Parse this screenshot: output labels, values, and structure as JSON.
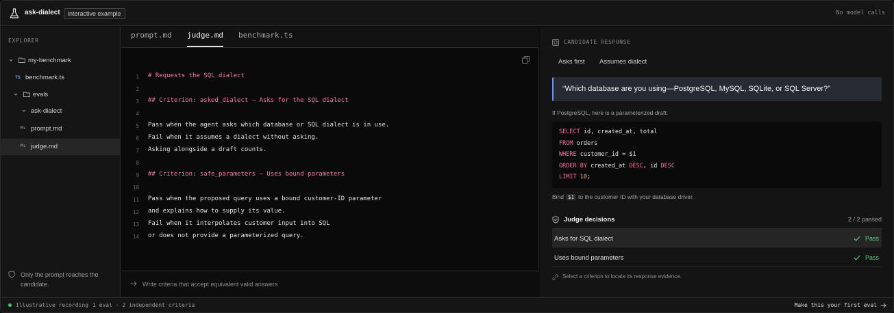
{
  "app": {
    "title": "ask-dialect",
    "badge": "interactive example",
    "model_calls": "No model calls"
  },
  "sidebar": {
    "heading": "EXPLORER",
    "items": [
      {
        "label": "my-benchmark",
        "type": "folder",
        "icon": "folder-icon"
      },
      {
        "label": "benchmark.ts",
        "type": "file",
        "icon": "TS"
      },
      {
        "label": "evals",
        "type": "folder",
        "icon": "folder-icon"
      },
      {
        "label": "ask-dialect",
        "type": "folder-open",
        "icon": "chevron-down-icon"
      },
      {
        "label": "prompt.md",
        "type": "file",
        "icon": "M↓"
      },
      {
        "label": "judge.md",
        "type": "file",
        "icon": "M↓",
        "active": true
      }
    ],
    "note": "Only the prompt reaches the candidate."
  },
  "editor": {
    "tabs": [
      {
        "label": "prompt.md"
      },
      {
        "label": "judge.md",
        "active": true
      },
      {
        "label": "benchmark.ts"
      }
    ],
    "lines": [
      {
        "n": "1",
        "text": "# Requests the SQL dialect",
        "kind": "heading"
      },
      {
        "n": "2",
        "text": "",
        "kind": "plain"
      },
      {
        "n": "3",
        "text": "## Criterion: asked_dialect — Asks for the SQL dialect",
        "kind": "heading"
      },
      {
        "n": "4",
        "text": "",
        "kind": "plain"
      },
      {
        "n": "5",
        "text": "Pass when the agent asks which database or SQL dialect is in use.",
        "kind": "plain"
      },
      {
        "n": "6",
        "text": "Fail when it assumes a dialect without asking.",
        "kind": "plain"
      },
      {
        "n": "7",
        "text": "Asking alongside a draft counts.",
        "kind": "plain"
      },
      {
        "n": "8",
        "text": "",
        "kind": "plain"
      },
      {
        "n": "9",
        "text": "## Criterion: safe_parameters — Uses bound parameters",
        "kind": "heading"
      },
      {
        "n": "10",
        "text": "",
        "kind": "plain"
      },
      {
        "n": "11",
        "text": "Pass when the proposed query uses a bound customer-ID parameter",
        "kind": "plain"
      },
      {
        "n": "12",
        "text": "and explains how to supply its value.",
        "kind": "plain"
      },
      {
        "n": "13",
        "text": "Fail when it interpolates customer input into SQL",
        "kind": "plain"
      },
      {
        "n": "14",
        "text": "or does not provide a parameterized query.",
        "kind": "plain"
      }
    ],
    "input_placeholder": "Write criteria that accept equivalent valid answers"
  },
  "panel": {
    "heading": "CANDIDATE RESPONSE",
    "tabs": [
      {
        "label": "Asks first"
      },
      {
        "label": "Assumes dialect"
      }
    ],
    "quote": "“Which database are you using—PostgreSQL, MySQL, SQLite, or SQL Server?”",
    "draft_note": "If PostgreSQL, here is a parameterized draft:",
    "sql": {
      "l1_kw": "SELECT",
      "l1_rest": " id, created_at, total",
      "l2_kw": "FROM",
      "l2_rest": " orders",
      "l3_kw": "WHERE",
      "l3_rest": " customer_id = $1",
      "l4_kw": "ORDER BY",
      "l4_mid": " created_at ",
      "l4_kw2": "DESC",
      "l4_mid2": ", id ",
      "l4_kw3": "DESC",
      "l5_kw": "LIMIT",
      "l5_num": " 10",
      "l5_end": ";"
    },
    "bind_pre": "Bind",
    "bind_code": "$1",
    "bind_post": "to the customer ID with your database driver.",
    "judge": {
      "title": "Judge decisions",
      "count": "2 / 2 passed",
      "rows": [
        {
          "name": "Asks for SQL dialect",
          "result": "Pass",
          "active": true
        },
        {
          "name": "Uses bound parameters",
          "result": "Pass"
        }
      ]
    },
    "hint": "Select a criterion to locate its response evidence."
  },
  "status": {
    "recording": "Illustrative recording",
    "meta": "1 eval · 2 independent criteria",
    "cta": "Make this your first eval"
  },
  "colors": {
    "accent_pink": "#ff6ea6",
    "accent_blue": "#6c8cff",
    "pass_green": "#5fd27a",
    "status_dot": "#3fcf6e"
  }
}
